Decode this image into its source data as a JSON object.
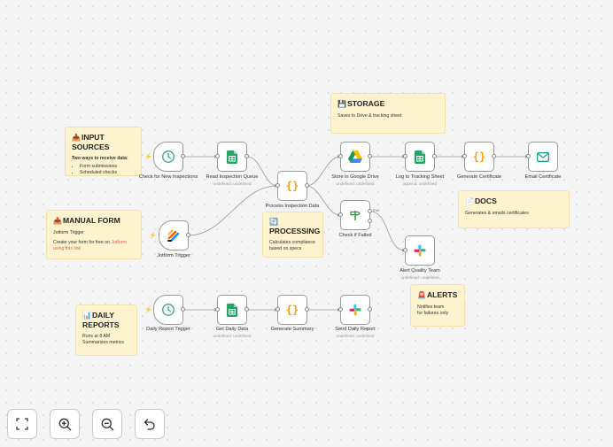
{
  "notes": {
    "input_sources": {
      "emoji": "📥",
      "title": "INPUT SOURCES",
      "intro": "Two ways to receive data:",
      "items": [
        "Form submissions",
        "Scheduled checks"
      ]
    },
    "manual_form": {
      "emoji": "📤",
      "title": "MANUAL FORM",
      "line1": "Jotform Trigger",
      "line2_prefix": "Create your form for free on ",
      "link_text": "Jotform using this link"
    },
    "storage": {
      "emoji": "💾",
      "title": "STORAGE",
      "body": "Saves to Drive & tracking sheet"
    },
    "processing": {
      "emoji": "🔄",
      "title": "PROCESSING",
      "body": "Calculates compliance based on specs"
    },
    "docs": {
      "emoji": "📄",
      "title": "DOCS",
      "body": "Generates & emails certificates"
    },
    "alerts": {
      "emoji": "🚨",
      "title": "ALERTS",
      "line1": "Notifies team",
      "line2": "for failures only"
    },
    "daily_reports": {
      "emoji": "📊",
      "title": "DAILY REPORTS",
      "line1": "Runs at 8 AM",
      "line2": "Summarizes metrics"
    }
  },
  "nodes": {
    "check_new": {
      "label": "Check for New Inspections",
      "icon": "clock-icon"
    },
    "read_queue": {
      "label": "Read Inspection Queue",
      "sub": "undefined: undefined",
      "icon": "google-sheets-icon"
    },
    "jotform": {
      "label": "Jotform Trigger",
      "icon": "jotform-icon"
    },
    "process": {
      "label": "Process Inspection Data",
      "icon": "code-braces-icon"
    },
    "store_drive": {
      "label": "Store in Google Drive",
      "sub": "undefined: undefined",
      "icon": "google-drive-icon"
    },
    "log_sheet": {
      "label": "Log to Tracking Sheet",
      "sub": "append: undefined",
      "icon": "google-sheets-icon"
    },
    "gen_cert": {
      "label": "Generate Certificate",
      "icon": "code-braces-icon"
    },
    "email_cert": {
      "label": "Email Certificate",
      "icon": "email-icon"
    },
    "check_failed": {
      "label": "Check if Failed",
      "icon": "if-signpost-icon"
    },
    "alert_team": {
      "label": "Alert Quality Team",
      "sub": "undefined: undefined",
      "icon": "slack-icon"
    },
    "daily_trigger": {
      "label": "Daily Report Trigger",
      "icon": "clock-icon"
    },
    "daily_data": {
      "label": "Get Daily Data",
      "sub": "undefined: undefined",
      "icon": "google-sheets-icon"
    },
    "gen_summary": {
      "label": "Generate Summary",
      "icon": "code-braces-icon"
    },
    "send_report": {
      "label": "Send Daily Report",
      "sub": "undefined: undefined",
      "icon": "slack-icon"
    }
  },
  "edge_labels": {
    "true": "true"
  },
  "controls": [
    "fit-view-icon",
    "zoom-in-icon",
    "zoom-out-icon",
    "undo-icon"
  ],
  "colors": {
    "trigger_bolt": "#ff6d5a",
    "note_bg": "#fdf3cf",
    "sheets_green": "#23a566",
    "code_orange": "#ff9c00",
    "email_teal": "#1aa48a"
  }
}
